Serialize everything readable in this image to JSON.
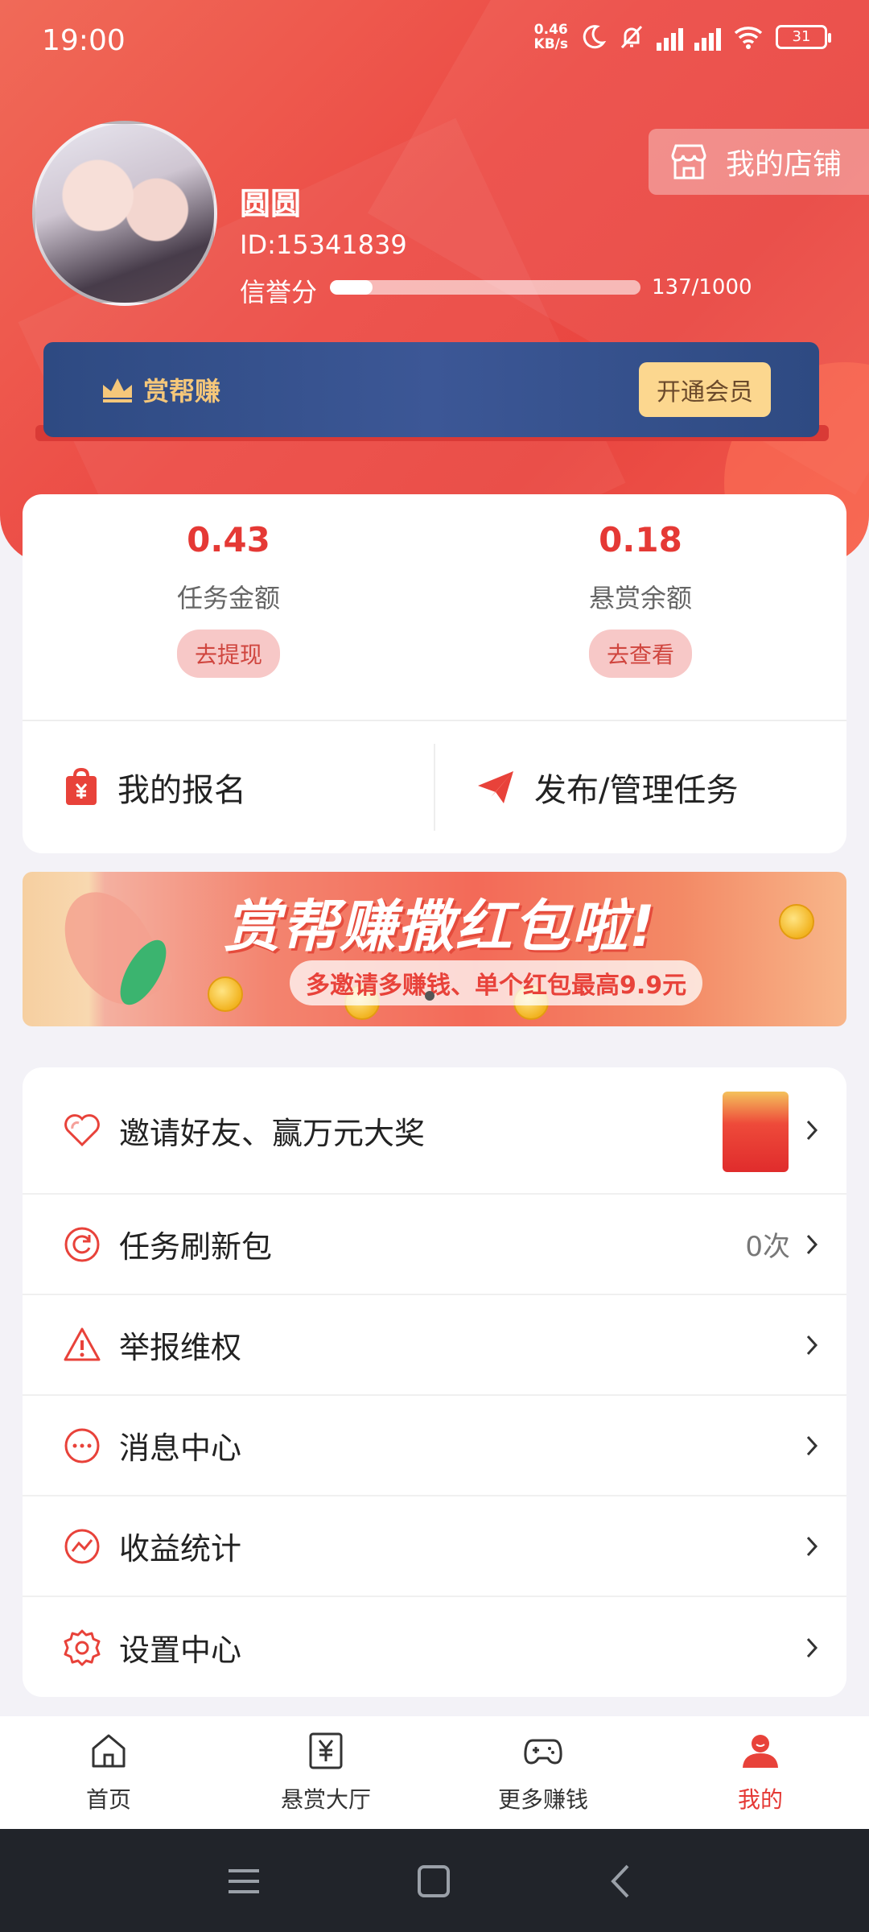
{
  "status_bar": {
    "time": "19:00",
    "net_speed_value": "0.46",
    "net_speed_unit": "KB/s",
    "battery": "31"
  },
  "profile": {
    "name": "圆圆",
    "id": "ID:15341839",
    "credit_label": "信誉分",
    "credit_value": "137/1000",
    "credit_progress": 0.137
  },
  "shop_button": {
    "label": "我的店铺"
  },
  "vip": {
    "brand": "赏帮赚",
    "button": "开通会员"
  },
  "wallet": {
    "task_amount": "0.43",
    "task_label": "任务金额",
    "task_button": "去提现",
    "reward_amount": "0.18",
    "reward_label": "悬赏余额",
    "reward_button": "去查看",
    "my_signup": "我的报名",
    "publish": "发布/管理任务"
  },
  "banner": {
    "title": "赏帮赚撒红包啦!",
    "subtitle": "多邀请多赚钱、单个红包最高9.9元"
  },
  "menu": [
    {
      "label": "邀请好友、赢万元大奖",
      "extra": "",
      "icon": "heart-icon"
    },
    {
      "label": "任务刷新包",
      "extra": "0次",
      "icon": "refresh-icon"
    },
    {
      "label": "举报维权",
      "extra": "",
      "icon": "warning-icon"
    },
    {
      "label": "消息中心",
      "extra": "",
      "icon": "message-icon"
    },
    {
      "label": "收益统计",
      "extra": "",
      "icon": "chart-icon"
    },
    {
      "label": "设置中心",
      "extra": "",
      "icon": "gear-icon"
    }
  ],
  "tabs": [
    {
      "label": "首页",
      "icon": "home-icon"
    },
    {
      "label": "悬赏大厅",
      "icon": "yuan-document-icon"
    },
    {
      "label": "更多赚钱",
      "icon": "gamepad-icon"
    },
    {
      "label": "我的",
      "icon": "user-icon",
      "active": true
    }
  ],
  "colors": {
    "primary": "#e94640",
    "vip_bg": "#34508c",
    "accent_red": "#e53935"
  }
}
